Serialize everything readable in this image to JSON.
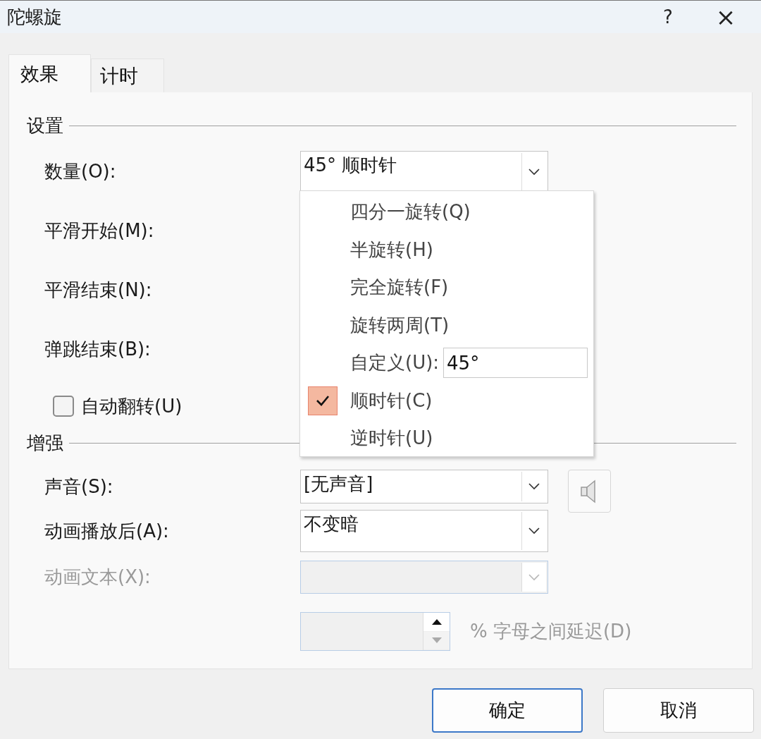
{
  "window": {
    "title": "陀螺旋",
    "help": "?",
    "close": "×"
  },
  "tabs": [
    {
      "label": "效果",
      "selected": true
    },
    {
      "label": "计时",
      "selected": false
    }
  ],
  "settings": {
    "title": "设置",
    "rows": [
      {
        "kind": "dropdown",
        "label": "数量(O):",
        "value": "45° 顺时针"
      },
      {
        "kind": "label",
        "label": "平滑开始(M):"
      },
      {
        "kind": "label",
        "label": "平滑结束(N):"
      },
      {
        "kind": "label",
        "label": "弹跳结束(B):"
      }
    ],
    "checkbox": {
      "label": "自动翻转(U)",
      "checked": false
    }
  },
  "enhancements": {
    "title": "增强",
    "rows": [
      {
        "kind": "dropdown",
        "label": "声音(S):",
        "value": "[无声音]",
        "disabled": false,
        "speaker": true
      },
      {
        "kind": "dropdown",
        "label": "动画播放后(A):",
        "value": "不变暗",
        "disabled": false,
        "speaker": false
      },
      {
        "kind": "dropdown",
        "label": "动画文本(X):",
        "disabled": true,
        "speaker": false
      },
      {
        "kind": "spin",
        "label": "% 字母之间延迟(D)",
        "disabled": true,
        "speaker": false
      }
    ]
  },
  "menu": {
    "items": [
      {
        "kind": "option",
        "label": "四分一旋转(Q)",
        "checked": false
      },
      {
        "kind": "option",
        "label": "半旋转(H)",
        "checked": false
      },
      {
        "kind": "option",
        "label": "完全旋转(F)",
        "checked": false
      },
      {
        "kind": "option",
        "label": "旋转两周(T)",
        "checked": false
      },
      {
        "kind": "custom",
        "label": "自定义(U):",
        "value": "45°",
        "checked": false
      },
      {
        "kind": "option",
        "label": "顺时针(C)",
        "checked": true
      },
      {
        "kind": "option",
        "label": "逆时针(U)",
        "checked": false
      }
    ]
  },
  "buttons": [
    {
      "label": "确定",
      "default": true
    },
    {
      "label": "取消",
      "default": false
    }
  ]
}
